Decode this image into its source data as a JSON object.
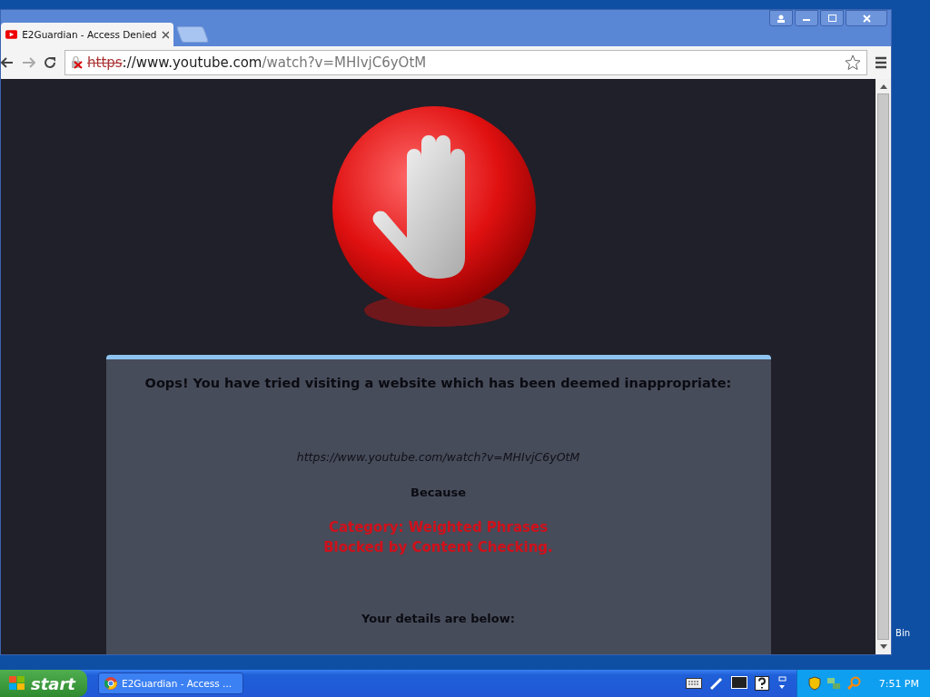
{
  "browser": {
    "tabs": [
      {
        "title": "E2Guardian - Access Denied",
        "selected": true
      }
    ],
    "address": {
      "scheme": "https",
      "host": "://www.youtube.com",
      "path": "/watch?v=MHIvjC6yOtM",
      "secure": false
    }
  },
  "page": {
    "heading": "Oops! You have tried visiting a website which has been deemed inappropriate:",
    "blocked_url": "https://www.youtube.com/watch?v=MHIvjC6yOtM",
    "because": "Because",
    "reasons": [
      "Category: Weighted Phrases",
      "Blocked by Content Checking."
    ],
    "details": "Your details are below:"
  },
  "desktop": {
    "icon_label": "Bin"
  },
  "taskbar": {
    "start": "start",
    "tasks": [
      {
        "title": "E2Guardian - Access ...",
        "selected": false
      }
    ],
    "clock": "7:51 PM"
  }
}
